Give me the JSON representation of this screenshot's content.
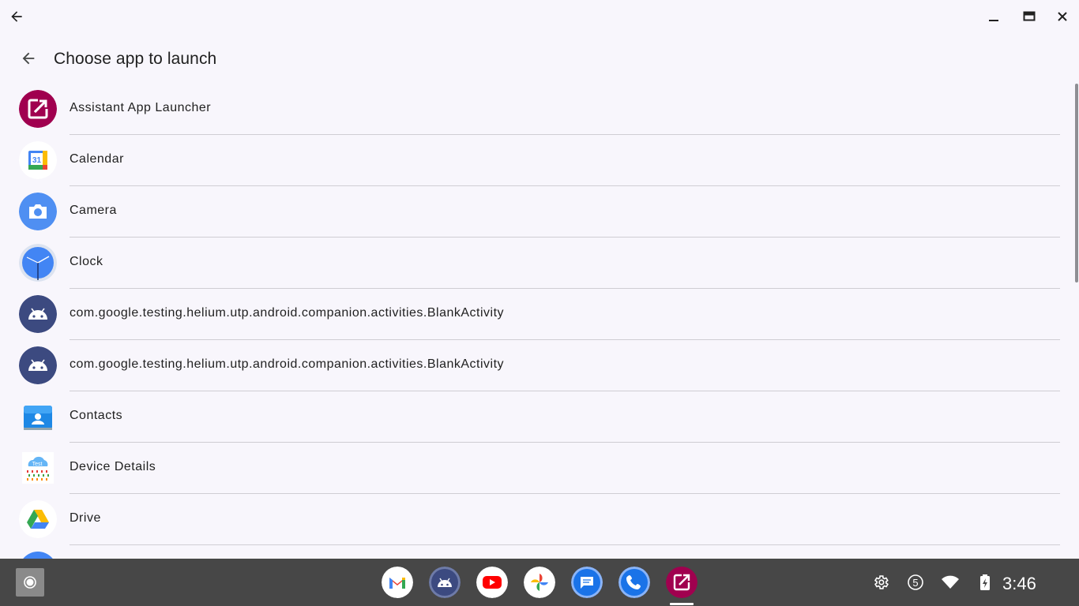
{
  "window": {
    "back_icon": "arrow-left-icon",
    "minimize_icon": "minimize-icon",
    "maximize_icon": "maximize-icon",
    "close_icon": "close-icon"
  },
  "header": {
    "back_icon": "arrow-left-icon",
    "title": "Choose app to launch"
  },
  "apps": [
    {
      "label": "Assistant App Launcher",
      "icon": "assistant-launcher-icon"
    },
    {
      "label": "Calendar",
      "icon": "calendar-icon"
    },
    {
      "label": "Camera",
      "icon": "camera-icon"
    },
    {
      "label": "Clock",
      "icon": "clock-icon"
    },
    {
      "label": "com.google.testing.helium.utp.android.companion.activities.BlankActivity",
      "icon": "android-icon"
    },
    {
      "label": "com.google.testing.helium.utp.android.companion.activities.BlankActivity",
      "icon": "android-icon"
    },
    {
      "label": "Contacts",
      "icon": "contacts-icon"
    },
    {
      "label": "Device Details",
      "icon": "device-details-icon"
    },
    {
      "label": "Drive",
      "icon": "drive-icon"
    }
  ],
  "taskbar": {
    "launcher_icon": "launcher-circle-icon",
    "shelf_apps": [
      "gmail-icon",
      "android-icon",
      "youtube-icon",
      "photos-icon",
      "messages-icon",
      "phone-icon",
      "assistant-launcher-icon"
    ],
    "tray": {
      "settings_icon": "gear-icon",
      "notification_count": "5",
      "wifi_icon": "wifi-icon",
      "battery_icon": "battery-charging-icon",
      "time": "3:46"
    }
  },
  "colors": {
    "background": "#f8f6fc",
    "taskbar": "#474747",
    "assistant": "#a0004f",
    "android_bg": "#3c4a80",
    "blue": "#4285f4"
  }
}
